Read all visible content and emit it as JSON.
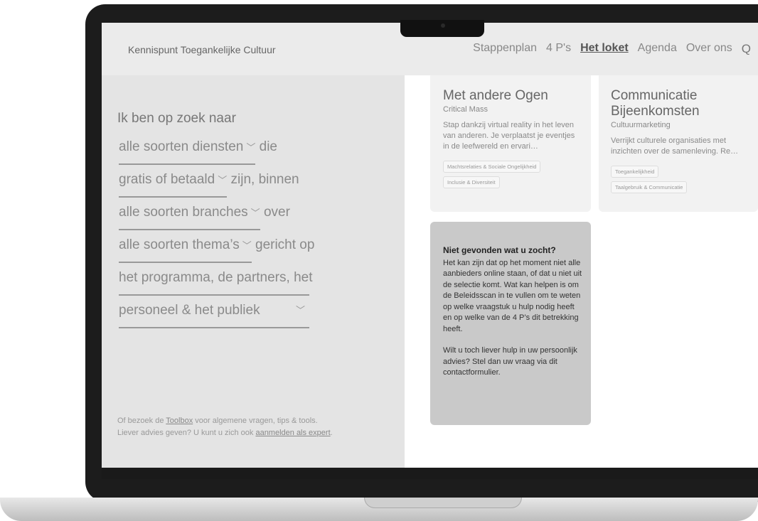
{
  "nav": {
    "brand": "Kennispunt Toegankelijke Cultuur",
    "links": [
      "Stappenplan",
      "4 P's",
      "Het loket",
      "Agenda",
      "Over ons"
    ],
    "search_glyph": "Q"
  },
  "filter": {
    "intro": "Ik ben op zoek naar",
    "lines": [
      {
        "select": "alle soorten diensten",
        "suffix": "die"
      },
      {
        "select": "gratis of betaald",
        "suffix": "zijn, binnen"
      },
      {
        "select": "alle soorten branches",
        "suffix": "over"
      },
      {
        "select": "alle soorten thema’s",
        "suffix": "gericht op"
      },
      {
        "select": "het programma, de partners, het",
        "suffix": ""
      },
      {
        "select": "personeel & het publiek",
        "suffix": ""
      }
    ],
    "bottom": {
      "line1_pre": "Of bezoek de ",
      "line1_link": "Toolbox",
      "line1_post": " voor algemene vragen, tips & tools.",
      "line2_pre": "Liever advies geven? U kunt u zich ook ",
      "line2_link": "aanmelden als expert",
      "line2_post": "."
    }
  },
  "cards": [
    {
      "title": "Met andere Ogen",
      "sub": "Critical Mass",
      "desc": "Stap dankzij virtual reality in het leven van anderen. Je verplaatst je eventjes in de leefwereld en ervari…",
      "tags": [
        "Machtsrelaties & Sociale Ongelijkheid",
        "Inclusie & Diversiteit"
      ]
    },
    {
      "title": "Communicatie Bijeenkomsten",
      "sub": "Cultuurmarketing",
      "desc": "Verrijkt culturele organisaties met inzichten over de samenleving. Re…",
      "tags": [
        "Toegankelijkheid",
        "Taalgebruik & Communicatie"
      ]
    }
  ],
  "info": {
    "title": "Niet gevonden wat u zocht?",
    "p1": "Het kan zijn dat op het moment niet alle aanbieders online staan, of dat u niet uit de selectie komt. Wat kan helpen is om de Beleidsscan in te vullen om te weten op welke vraagstuk u hulp nodig heeft en op welke van de 4 P’s dit betrekking heeft.",
    "p2": "Wilt u toch liever hulp in uw persoonlijk advies? Stel dan uw vraag via dit contactformulier."
  }
}
